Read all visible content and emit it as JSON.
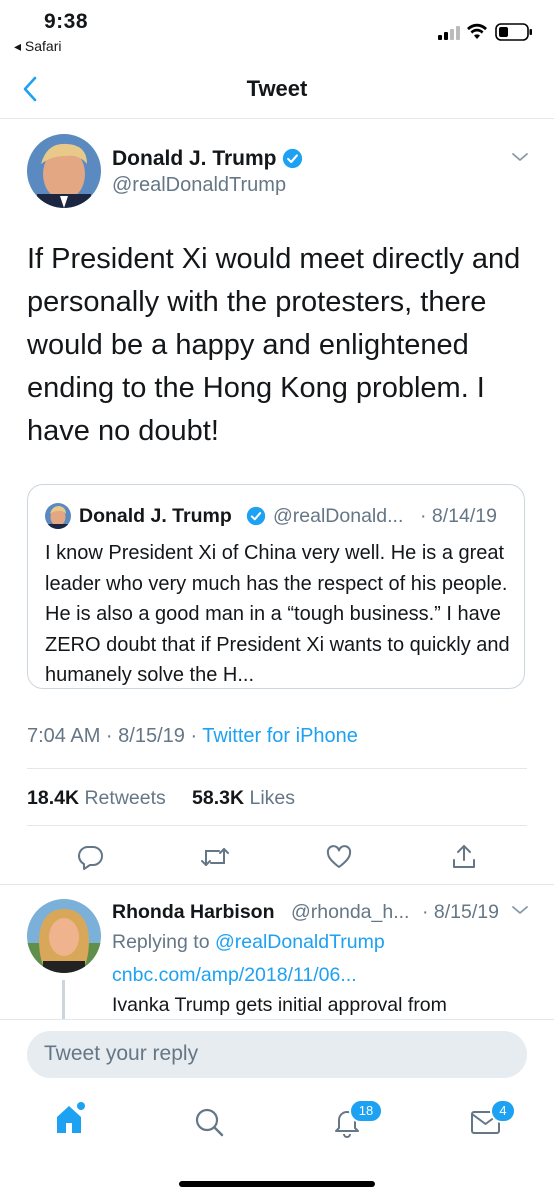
{
  "status_bar": {
    "time": "9:38",
    "back_app": "◂ Safari"
  },
  "nav": {
    "title": "Tweet"
  },
  "tweet": {
    "author_name": "Donald J. Trump",
    "author_handle": "@realDonaldTrump",
    "text": "If President Xi would meet directly and personally with the protesters, there would be a happy and enlightened ending to the Hong Kong problem. I have no doubt!",
    "time": "7:04 AM · 8/15/19 · ",
    "source": "Twitter for iPhone",
    "retweets_count": "18.4K",
    "retweets_label": "Retweets",
    "likes_count": "58.3K",
    "likes_label": "Likes"
  },
  "quote": {
    "author_name": "Donald J. Trump",
    "author_handle": "@realDonald...",
    "date": "· 8/14/19",
    "text": "I know President Xi of China very well. He is a great leader who very much has the respect of his people. He is also a good man in a “tough business.” I have ZERO doubt that if President Xi wants to quickly and humanely solve the H..."
  },
  "reply": {
    "author_name": "Rhonda Harbison",
    "author_handle": "@rhonda_h...",
    "date": "· 8/15/19",
    "replying_label": "Replying to ",
    "replying_to": "@realDonaldTrump",
    "link": "cnbc.com/amp/2018/11/06...",
    "text": "Ivanka Trump gets initial approval from"
  },
  "composer": {
    "placeholder": "Tweet your reply"
  },
  "tab_bar": {
    "notifications_badge": "18",
    "messages_badge": "4"
  },
  "colors": {
    "accent": "#1da1f2",
    "secondary_text": "#657786",
    "divider": "#e1e8ed"
  }
}
